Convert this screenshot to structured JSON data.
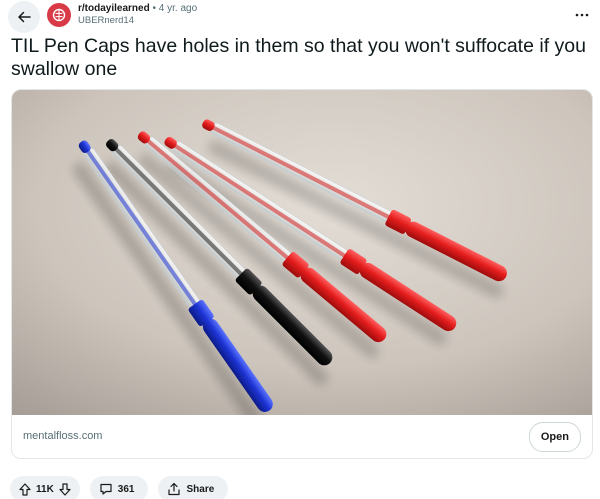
{
  "post": {
    "subreddit": "r/todayilearned",
    "separator": "•",
    "age": "4 yr. ago",
    "author": "UBERnerd14",
    "title": "TIL Pen Caps have holes in them so that you won't suffocate if you swallow one"
  },
  "link_card": {
    "domain": "mentalfloss.com",
    "open_label": "Open"
  },
  "actions": {
    "votes": "11K",
    "comments": "361",
    "share_label": "Share"
  },
  "icons": {
    "back": "arrow-left-icon",
    "subreddit_avatar": "brain-icon",
    "more": "more-horizontal-icon",
    "upvote": "upvote-arrow-icon",
    "downvote": "downvote-arrow-icon",
    "comment": "comment-bubble-icon",
    "share": "share-icon"
  },
  "colors": {
    "subreddit_avatar_bg": "#d93a47",
    "pill_bg": "#eef1f3",
    "meta_text": "#576f76",
    "pen_red": "#e51d1d",
    "pen_blue": "#1d34d4",
    "pen_black": "#111111"
  }
}
